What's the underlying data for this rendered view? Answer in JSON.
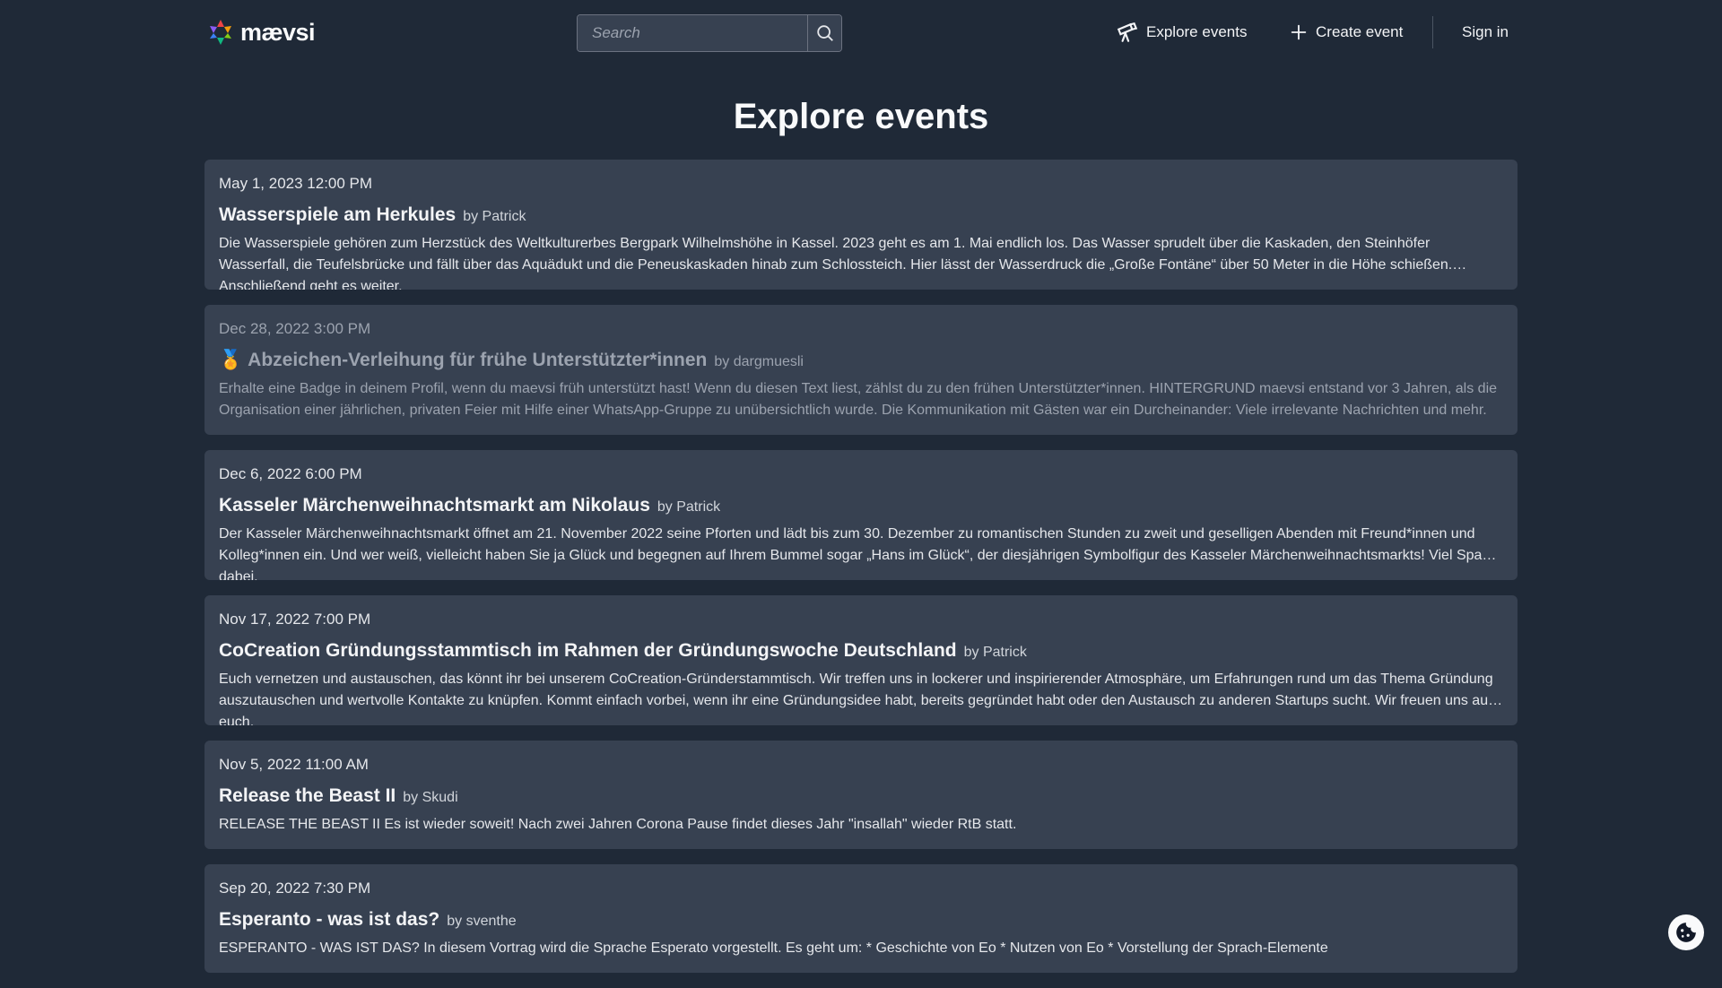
{
  "header": {
    "logo_text": "mævsi",
    "search_placeholder": "Search",
    "nav_explore": "Explore events",
    "nav_create": "Create event",
    "nav_signin": "Sign in"
  },
  "page_title": "Explore events",
  "events": [
    {
      "date": "May 1, 2023 12:00 PM",
      "title": "Wasserspiele am Herkules",
      "author": "by Patrick",
      "description": "Die Wasserspiele gehören zum Herzstück des Weltkulturerbes Bergpark Wilhelmshöhe in Kassel. 2023 geht es am 1. Mai endlich los. Das Wasser sprudelt über die Kaskaden, den Steinhöfer Wasserfall, die Teufelsbrücke und fällt über das Aquädukt und die Peneuskaskaden hinab zum Schlossteich. Hier lässt der Wasserdruck die „Große Fontäne“ über 50 Meter in die Höhe schießen. Anschließend geht es weiter."
    },
    {
      "date": "Dec 28, 2022 3:00 PM",
      "title": "Abzeichen-Verleihung für frühe Unterstützter*innen",
      "author": "by dargmuesli",
      "description": "Erhalte eine Badge in deinem Profil, wenn du maevsi früh unterstützt hast! Wenn du diesen Text liest, zählst du zu den frühen Unterstützter*innen. HINTERGRUND maevsi entstand vor 3 Jahren, als die Organisation einer jährlichen, privaten Feier mit Hilfe einer WhatsApp-Gruppe zu unübersichtlich wurde. Die Kommunikation mit Gästen war ein Durcheinander: Viele irrelevante Nachrichten und mehr."
    },
    {
      "date": "Dec 6, 2022 6:00 PM",
      "title": "Kasseler Märchenweihnachtsmarkt am Nikolaus",
      "author": "by Patrick",
      "description": "Der Kasseler Märchenweihnachtsmarkt öffnet am 21. November 2022 seine Pforten und lädt bis zum 30. Dezember zu romantischen Stunden zu zweit und geselligen Abenden mit Freund*innen und Kolleg*innen ein. Und wer weiß, vielleicht haben Sie ja Glück und begegnen auf Ihrem Bummel sogar „Hans im Glück“, der diesjährigen Symbolfigur des Kasseler Märchenweihnachtsmarkts! Viel Spaß dabei."
    },
    {
      "date": "Nov 17, 2022 7:00 PM",
      "title": "CoCreation Gründungsstammtisch im Rahmen der Gründungswoche Deutschland",
      "author": "by Patrick",
      "description": "Euch vernetzen und austauschen, das könnt ihr bei unserem CoCreation-Gründerstammtisch. Wir treffen uns in lockerer und inspirierender Atmosphäre, um Erfahrungen rund um das Thema Gründung auszutauschen und wertvolle Kontakte zu knüpfen. Kommt einfach vorbei, wenn ihr eine Gründungsidee habt, bereits gegründet habt oder den Austausch zu anderen Startups sucht. Wir freuen uns auf euch."
    },
    {
      "date": "Nov 5, 2022 11:00 AM",
      "title": "Release the Beast II",
      "author": "by Skudi",
      "description": "RELEASE THE BEAST II Es ist wieder soweit! Nach zwei Jahren Corona Pause findet dieses Jahr \"insallah\" wieder RtB statt."
    },
    {
      "date": "Sep 20, 2022 7:30 PM",
      "title": "Esperanto - was ist das?",
      "author": "by sventhe",
      "description": "ESPERANTO - WAS IST DAS? In diesem Vortrag wird die Sprache Esperato vorgestellt. Es geht um: * Geschichte von Eo * Nutzen von Eo * Vorstellung der Sprach-Elemente"
    }
  ],
  "colors": {
    "background": "#1f2937",
    "card": "#374151",
    "text": "#f3f4f6"
  }
}
